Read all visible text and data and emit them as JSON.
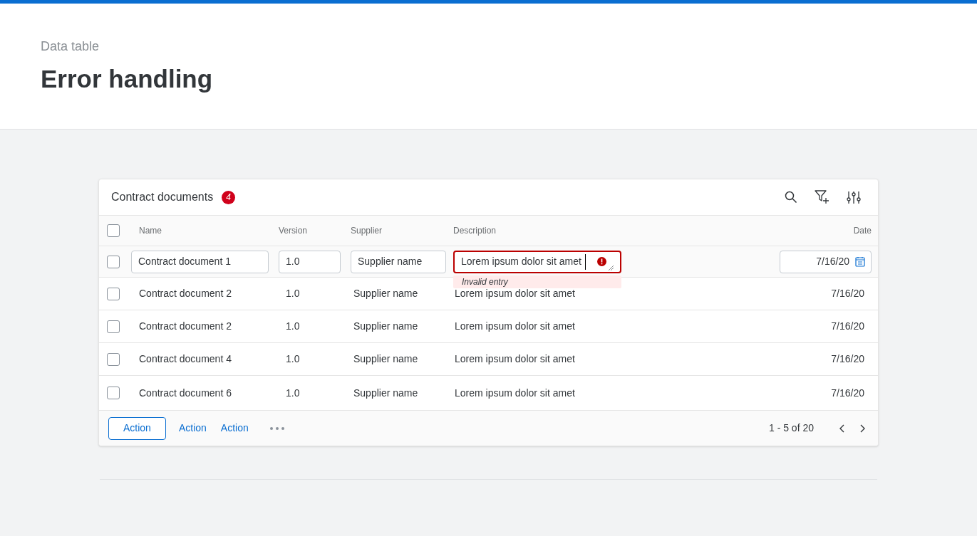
{
  "header": {
    "subtitle": "Data table",
    "title": "Error handling"
  },
  "table": {
    "title": "Contract documents",
    "count": "4",
    "select_all": {
      "checked": false
    },
    "columns": [
      "Name",
      "Version",
      "Supplier",
      "Description",
      "Date"
    ],
    "rows": [
      {
        "kind": "edit",
        "checked": false,
        "name": "Contract document 1",
        "version": "1.0",
        "supplier": "Supplier name",
        "description": "Lorem ipsum dolor sit amet",
        "date": "7/16/20",
        "error": "Invalid entry"
      },
      {
        "kind": "display",
        "checked": false,
        "name": "Contract document 2",
        "version": "1.0",
        "supplier": "Supplier name",
        "description": "Lorem ipsum dolor sit amet",
        "date": "7/16/20"
      },
      {
        "kind": "display",
        "checked": false,
        "name": "Contract document 2",
        "version": "1.0",
        "supplier": "Supplier name",
        "description": "Lorem ipsum dolor sit amet",
        "date": "7/16/20"
      },
      {
        "kind": "display",
        "checked": false,
        "name": "Contract document 4",
        "version": "1.0",
        "supplier": "Supplier name",
        "description": "Lorem ipsum dolor sit amet",
        "date": "7/16/20"
      },
      {
        "kind": "display",
        "checked": false,
        "name": "Contract document 6",
        "version": "1.0",
        "supplier": "Supplier name",
        "description": "Lorem ipsum dolor sit amet",
        "date": "7/16/20"
      }
    ],
    "actions": [
      {
        "label": "Action",
        "kind": "outlined"
      },
      {
        "label": "Action",
        "kind": "link"
      },
      {
        "label": "Action",
        "kind": "link"
      }
    ],
    "pagination": "1 - 5 of 20"
  }
}
